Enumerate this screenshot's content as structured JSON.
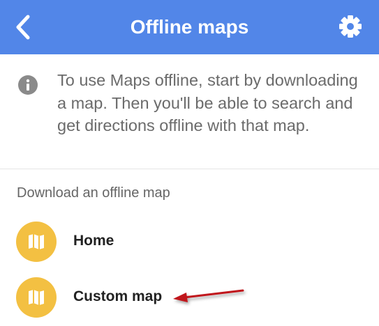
{
  "header": {
    "title": "Offline maps",
    "back_icon": "chevron-left-icon",
    "settings_icon": "gear-icon",
    "background_color": "#5286E8"
  },
  "info": {
    "icon": "info-icon",
    "text": "To use Maps offline, start by downloading a map. Then you'll be able to search and get directions offline with that map."
  },
  "download_section": {
    "heading": "Download an offline map",
    "items": [
      {
        "label": "Home",
        "icon": "map-icon"
      },
      {
        "label": "Custom map",
        "icon": "map-icon"
      }
    ],
    "icon_color": "#F3C042"
  },
  "annotation": {
    "type": "arrow",
    "color": "#C0191E",
    "points_to": "Custom map"
  }
}
